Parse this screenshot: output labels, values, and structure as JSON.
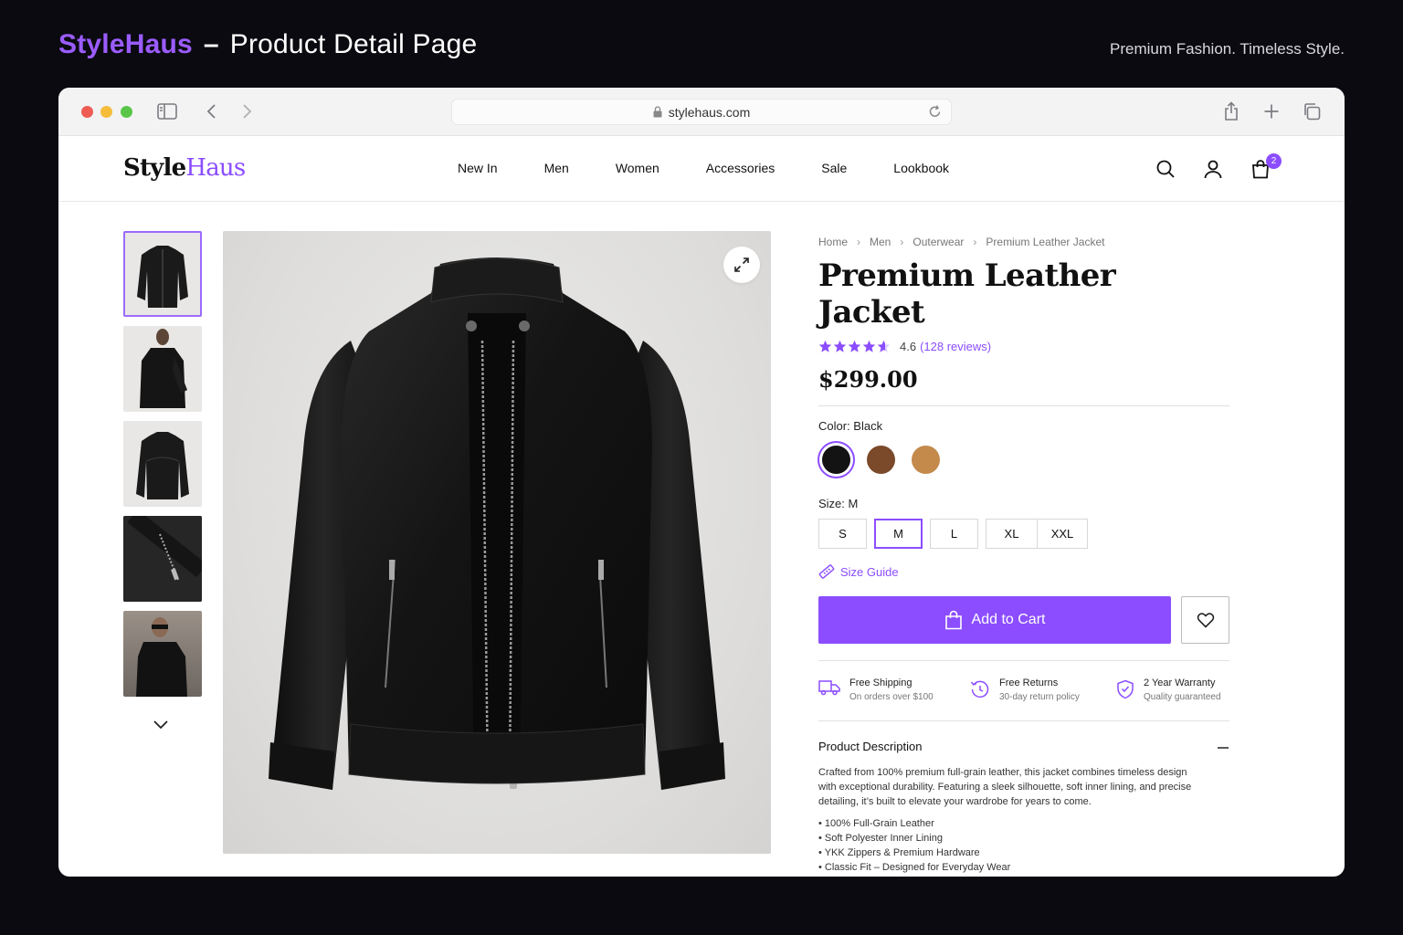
{
  "header": {
    "brand": "StyleHaus",
    "separator": "–",
    "subtitle": "Product Detail Page",
    "tagline": "Premium Fashion. Timeless Style."
  },
  "browser": {
    "url": "stylehaus.com"
  },
  "site": {
    "logo_style": "Style",
    "logo_haus": "Haus",
    "nav": [
      "New In",
      "Men",
      "Women",
      "Accessories",
      "Sale",
      "Lookbook"
    ],
    "cart_count": "2"
  },
  "product": {
    "breadcrumb": [
      "Home",
      "Men",
      "Outerwear",
      "Premium Leather Jacket"
    ],
    "title": "Premium Leather Jacket",
    "rating": 4.6,
    "rating_text": "4.6",
    "reviews_text": "(128 reviews)",
    "price": "$299.00",
    "color_label": "Color: Black",
    "colors": [
      {
        "name": "Black",
        "hex": "#131313",
        "selected": true
      },
      {
        "name": "Brown",
        "hex": "#7a4a2a",
        "selected": false
      },
      {
        "name": "Tan",
        "hex": "#c48a4c",
        "selected": false
      }
    ],
    "size_label": "Size: M",
    "sizes": [
      "S",
      "M",
      "L",
      "XL",
      "XXL"
    ],
    "selected_size": "M",
    "size_guide": "Size Guide",
    "add_to_cart": "Add to Cart",
    "features": [
      {
        "title": "Free Shipping",
        "sub": "On orders over $100",
        "icon": "truck-icon"
      },
      {
        "title": "Free Returns",
        "sub": "30-day return policy",
        "icon": "return-icon"
      },
      {
        "title": "2 Year Warranty",
        "sub": "Quality guaranteed",
        "icon": "shield-icon"
      }
    ],
    "description_title": "Product Description",
    "description": "Crafted from 100% premium full-grain leather, this jacket combines timeless design with exceptional durability. Featuring a sleek silhouette, soft inner lining, and precise detailing, it’s built to elevate your wardrobe for years to come.",
    "bullets": [
      "100% Full-Grain Leather",
      "Soft Polyester Inner Lining",
      "YKK Zippers & Premium Hardware",
      "Classic Fit – Designed for Everyday Wear"
    ]
  },
  "colors": {
    "accent": "#8b4dff",
    "background": "#0a0a10"
  }
}
